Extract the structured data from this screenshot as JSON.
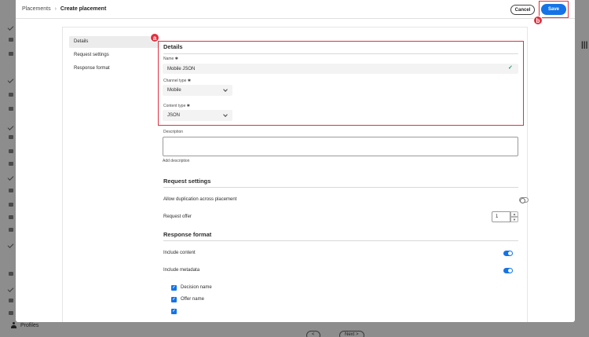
{
  "background": {
    "profiles_label": "Profiles",
    "right_icon": "|||",
    "pager_prev": "<",
    "pager_next": "Next >"
  },
  "header": {
    "breadcrumb_root": "Placements",
    "breadcrumb_separator": "›",
    "breadcrumb_current": "Create placement",
    "cancel_label": "Cancel",
    "save_label": "Save"
  },
  "callouts": {
    "a": "a",
    "b": "b"
  },
  "side_nav": {
    "items": [
      {
        "label": "Details",
        "active": true
      },
      {
        "label": "Request settings",
        "active": false
      },
      {
        "label": "Response format",
        "active": false
      }
    ]
  },
  "details": {
    "title": "Details",
    "name_label": "Name",
    "name_value": "Mobile JSON",
    "required_marker": "✱",
    "channel_type_label": "Channel type",
    "channel_type_value": "Mobile",
    "content_type_label": "Content type",
    "content_type_value": "JSON",
    "description_label": "Description",
    "add_description_label": "Add description"
  },
  "request_settings": {
    "title": "Request settings",
    "allow_duplication_label": "Allow duplication across placement",
    "allow_duplication_on": false,
    "request_offer_label": "Request offer",
    "request_offer_value": "1"
  },
  "response_format": {
    "title": "Response format",
    "include_content_label": "Include content",
    "include_content_on": true,
    "include_metadata_label": "Include metadata",
    "include_metadata_on": true,
    "metadata_options": [
      {
        "label": "Decision name",
        "checked": true
      },
      {
        "label": "Offer name",
        "checked": true
      }
    ]
  },
  "colors": {
    "accent": "#1473e6",
    "callout": "#e0313f",
    "success": "#268e6c"
  }
}
